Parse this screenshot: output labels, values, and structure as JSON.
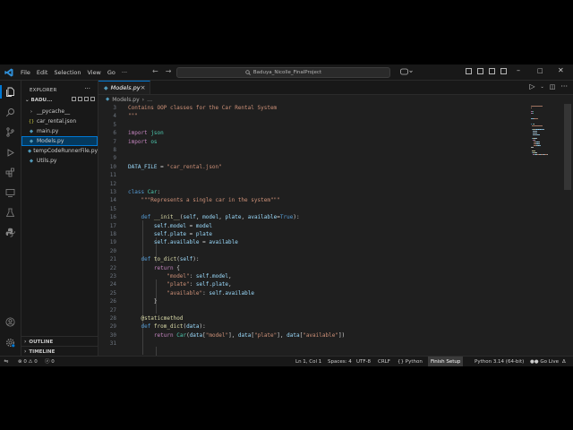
{
  "colors": {
    "accent": "#0078d4",
    "bg_editor": "#1f1f1f",
    "bg_chrome": "#181818"
  },
  "titlebar": {
    "menus": [
      "File",
      "Edit",
      "Selection",
      "View",
      "Go",
      "···"
    ],
    "search": "Baduya_Nicolle_FinalProject",
    "icons": [
      "back-arrow-icon",
      "forward-arrow-icon",
      "search-icon",
      "copilot-icon",
      "layout-icon",
      "minimize-icon",
      "maximize-icon",
      "close-icon"
    ]
  },
  "sidebar": {
    "title": "EXPLORER",
    "more": "···",
    "folder": "BADU...",
    "files": [
      {
        "name": "__pycache__",
        "icon": "›",
        "kind": "folder"
      },
      {
        "name": "car_rental.json",
        "icon": "{}",
        "kind": "json"
      },
      {
        "name": "main.py",
        "icon": "◆",
        "kind": "py"
      },
      {
        "name": "Models.py",
        "icon": "◆",
        "kind": "py",
        "active": true
      },
      {
        "name": "tempCodeRunnerFile.py",
        "icon": "◆",
        "kind": "py"
      },
      {
        "name": "Utils.py",
        "icon": "◆",
        "kind": "py"
      }
    ],
    "sections": [
      "OUTLINE",
      "TIMELINE"
    ]
  },
  "editor": {
    "tab": "Models.py",
    "breadcrumb": [
      "Models.py",
      "›",
      "…"
    ],
    "lines": [
      {
        "n": "3",
        "t": [
          [
            "c-str",
            "Contains OOP classes for the Car Rental System"
          ]
        ]
      },
      {
        "n": "4",
        "t": [
          [
            "c-str",
            "\"\"\""
          ]
        ]
      },
      {
        "n": "5",
        "t": []
      },
      {
        "n": "6",
        "t": [
          [
            "c-kw",
            "import"
          ],
          [
            "c-pl",
            " "
          ],
          [
            "c-mod",
            "json"
          ]
        ]
      },
      {
        "n": "7",
        "t": [
          [
            "c-kw",
            "import"
          ],
          [
            "c-pl",
            " "
          ],
          [
            "c-mod",
            "os"
          ]
        ]
      },
      {
        "n": "8",
        "t": []
      },
      {
        "n": "9",
        "t": []
      },
      {
        "n": "10",
        "t": [
          [
            "c-var",
            "DATA_FILE"
          ],
          [
            "c-pl",
            " = "
          ],
          [
            "c-str",
            "\"car_rental.json\""
          ]
        ]
      },
      {
        "n": "11",
        "t": []
      },
      {
        "n": "12",
        "t": []
      },
      {
        "n": "13",
        "t": [
          [
            "c-kw2",
            "class"
          ],
          [
            "c-pl",
            " "
          ],
          [
            "c-mod",
            "Car"
          ],
          [
            "c-pl",
            ":"
          ]
        ]
      },
      {
        "n": "14",
        "t": [
          [
            "c-pl",
            "    "
          ],
          [
            "c-str",
            "\"\"\"Represents a single car in the system\"\"\""
          ]
        ]
      },
      {
        "n": "15",
        "t": []
      },
      {
        "n": "16",
        "t": [
          [
            "c-pl",
            "    "
          ],
          [
            "c-kw2",
            "def"
          ],
          [
            "c-pl",
            " "
          ],
          [
            "c-fn",
            "__init__"
          ],
          [
            "c-pl",
            "("
          ],
          [
            "c-var",
            "self"
          ],
          [
            "c-pl",
            ", "
          ],
          [
            "c-var",
            "model"
          ],
          [
            "c-pl",
            ", "
          ],
          [
            "c-var",
            "plate"
          ],
          [
            "c-pl",
            ", "
          ],
          [
            "c-var",
            "available"
          ],
          [
            "c-pl",
            "="
          ],
          [
            "c-kw2",
            "True"
          ],
          [
            "c-pl",
            "):"
          ]
        ]
      },
      {
        "n": "17",
        "t": [
          [
            "c-pl",
            "        "
          ],
          [
            "c-var",
            "self"
          ],
          [
            "c-pl",
            "."
          ],
          [
            "c-var",
            "model"
          ],
          [
            "c-pl",
            " = "
          ],
          [
            "c-var",
            "model"
          ]
        ]
      },
      {
        "n": "18",
        "t": [
          [
            "c-pl",
            "        "
          ],
          [
            "c-var",
            "self"
          ],
          [
            "c-pl",
            "."
          ],
          [
            "c-var",
            "plate"
          ],
          [
            "c-pl",
            " = "
          ],
          [
            "c-var",
            "plate"
          ]
        ]
      },
      {
        "n": "19",
        "t": [
          [
            "c-pl",
            "        "
          ],
          [
            "c-var",
            "self"
          ],
          [
            "c-pl",
            "."
          ],
          [
            "c-var",
            "available"
          ],
          [
            "c-pl",
            " = "
          ],
          [
            "c-var",
            "available"
          ]
        ]
      },
      {
        "n": "20",
        "t": []
      },
      {
        "n": "21",
        "t": [
          [
            "c-pl",
            "    "
          ],
          [
            "c-kw2",
            "def"
          ],
          [
            "c-pl",
            " "
          ],
          [
            "c-fn",
            "to_dict"
          ],
          [
            "c-pl",
            "("
          ],
          [
            "c-var",
            "self"
          ],
          [
            "c-pl",
            "):"
          ]
        ]
      },
      {
        "n": "22",
        "t": [
          [
            "c-pl",
            "        "
          ],
          [
            "c-kw",
            "return"
          ],
          [
            "c-pl",
            " {"
          ]
        ]
      },
      {
        "n": "23",
        "t": [
          [
            "c-pl",
            "            "
          ],
          [
            "c-str",
            "\"model\""
          ],
          [
            "c-pl",
            ": "
          ],
          [
            "c-var",
            "self"
          ],
          [
            "c-pl",
            "."
          ],
          [
            "c-var",
            "model"
          ],
          [
            "c-pl",
            ","
          ]
        ]
      },
      {
        "n": "24",
        "t": [
          [
            "c-pl",
            "            "
          ],
          [
            "c-str",
            "\"plate\""
          ],
          [
            "c-pl",
            ": "
          ],
          [
            "c-var",
            "self"
          ],
          [
            "c-pl",
            "."
          ],
          [
            "c-var",
            "plate"
          ],
          [
            "c-pl",
            ","
          ]
        ]
      },
      {
        "n": "25",
        "t": [
          [
            "c-pl",
            "            "
          ],
          [
            "c-str",
            "\"available\""
          ],
          [
            "c-pl",
            ": "
          ],
          [
            "c-var",
            "self"
          ],
          [
            "c-pl",
            "."
          ],
          [
            "c-var",
            "available"
          ]
        ]
      },
      {
        "n": "26",
        "t": [
          [
            "c-pl",
            "        }"
          ]
        ]
      },
      {
        "n": "27",
        "t": []
      },
      {
        "n": "28",
        "t": [
          [
            "c-pl",
            "    "
          ],
          [
            "c-dec",
            "@staticmethod"
          ]
        ]
      },
      {
        "n": "29",
        "t": [
          [
            "c-pl",
            "    "
          ],
          [
            "c-kw2",
            "def"
          ],
          [
            "c-pl",
            " "
          ],
          [
            "c-fn",
            "from_dict"
          ],
          [
            "c-pl",
            "("
          ],
          [
            "c-var",
            "data"
          ],
          [
            "c-pl",
            "):"
          ]
        ]
      },
      {
        "n": "30",
        "t": [
          [
            "c-pl",
            "        "
          ],
          [
            "c-kw",
            "return"
          ],
          [
            "c-pl",
            " "
          ],
          [
            "c-mod",
            "Car"
          ],
          [
            "c-pl",
            "("
          ],
          [
            "c-var",
            "data"
          ],
          [
            "c-pl",
            "["
          ],
          [
            "c-str",
            "\"model\""
          ],
          [
            "c-pl",
            "], "
          ],
          [
            "c-var",
            "data"
          ],
          [
            "c-pl",
            "["
          ],
          [
            "c-str",
            "\"plate\""
          ],
          [
            "c-pl",
            "], "
          ],
          [
            "c-var",
            "data"
          ],
          [
            "c-pl",
            "["
          ],
          [
            "c-str",
            "\"available\""
          ],
          [
            "c-pl",
            "])"
          ]
        ]
      },
      {
        "n": "31",
        "t": []
      }
    ]
  },
  "statusbar": {
    "problems": "⊗ 0 ⚠ 0",
    "ports": "ⓥ 0",
    "position": "Ln 1, Col 1",
    "spaces": "Spaces: 4",
    "encoding": "UTF-8",
    "eol": "CRLF",
    "language": "{} Python",
    "finish": "Finish Setup",
    "interpreter": "Python 3.14 (64-bit)",
    "golive": "●● Go Live",
    "bell": "Δ"
  }
}
